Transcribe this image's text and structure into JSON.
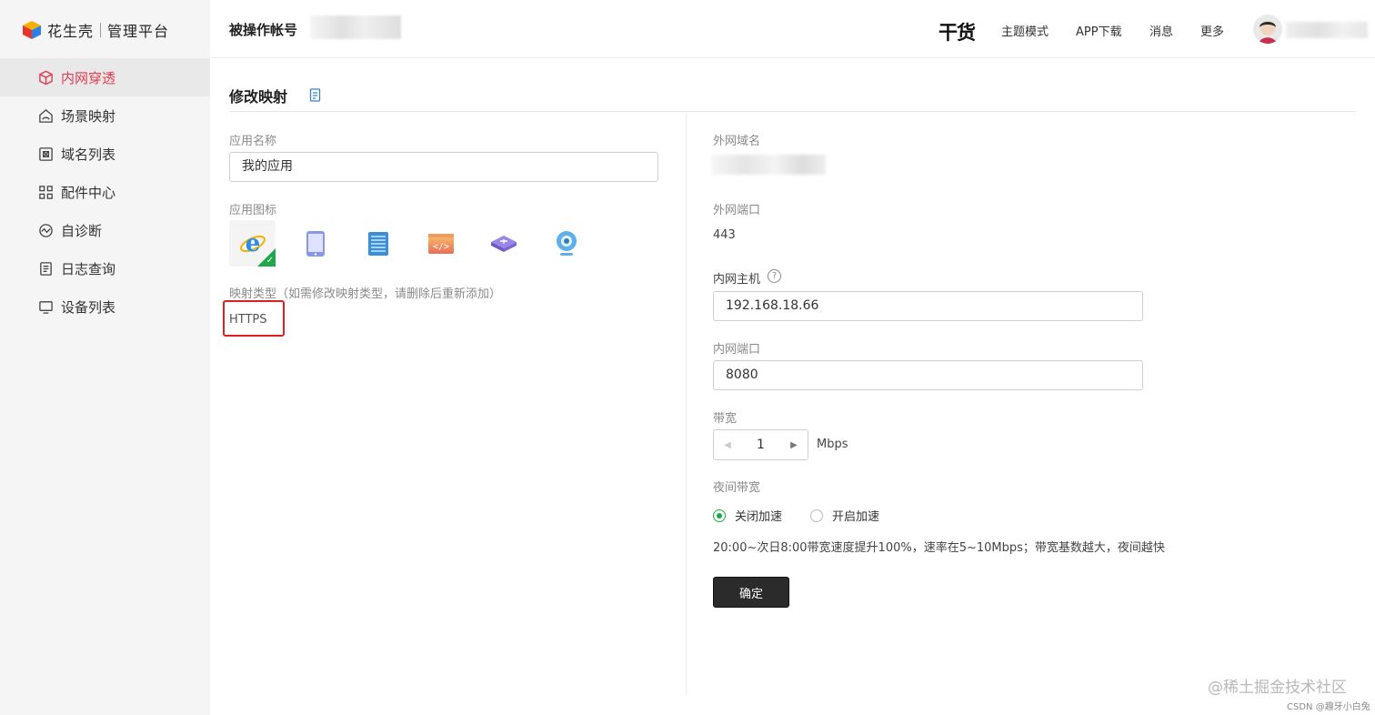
{
  "sidebar": {
    "brand": "花生壳",
    "brand_sub": "管理平台",
    "items": [
      {
        "label": "内网穿透",
        "icon": "cube-icon",
        "active": true
      },
      {
        "label": "场景映射",
        "icon": "scene-icon"
      },
      {
        "label": "域名列表",
        "icon": "domain-icon"
      },
      {
        "label": "配件中心",
        "icon": "grid-icon"
      },
      {
        "label": "自诊断",
        "icon": "diagnose-icon"
      },
      {
        "label": "日志查询",
        "icon": "log-icon"
      },
      {
        "label": "设备列表",
        "icon": "monitor-icon"
      }
    ]
  },
  "header": {
    "account_label": "被操作帐号",
    "ganhuo": "干货",
    "links": [
      "主题模式",
      "APP下载",
      "消息",
      "更多"
    ]
  },
  "page": {
    "title": "修改映射",
    "app_name_label": "应用名称",
    "app_name_value": "我的应用",
    "app_icon_label": "应用图标",
    "app_icons": [
      "ie-icon",
      "tablet-icon",
      "server-icon",
      "code-icon",
      "router-icon",
      "webcam-icon"
    ],
    "mapping_type_label": "映射类型（如需修改映射类型，请删除后重新添加）",
    "mapping_type_value": "HTTPS",
    "ext_domain_label": "外网域名",
    "ext_port_label": "外网端口",
    "ext_port_value": "443",
    "int_host_label": "内网主机",
    "int_host_value": "192.168.18.66",
    "int_port_label": "内网端口",
    "int_port_value": "8080",
    "bandwidth_label": "带宽",
    "bandwidth_value": "1",
    "bandwidth_unit": "Mbps",
    "night_label": "夜间带宽",
    "night_options": [
      "关闭加速",
      "开启加速"
    ],
    "night_selected": "关闭加速",
    "night_hint": "20:00~次日8:00带宽速度提升100%，速率在5~10Mbps；带宽基数越大，夜间越快",
    "confirm": "确定"
  },
  "watermark": "@稀土掘金技术社区",
  "watermark2": "CSDN @趣牙小白兔",
  "colors": {
    "accent_active": "#e23b51",
    "radio_green": "#1ea84a",
    "highlight_box": "#e02020"
  }
}
